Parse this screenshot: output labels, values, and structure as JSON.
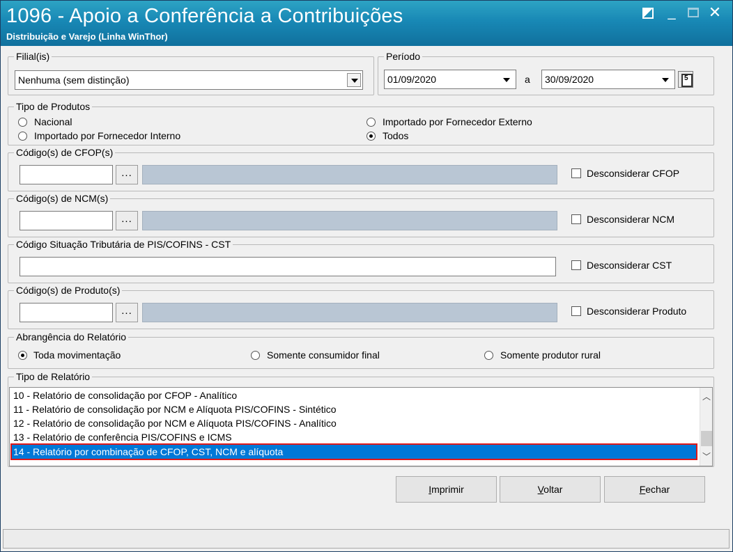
{
  "window": {
    "title": "1096 - Apoio a Conferência a Contribuições",
    "subtitle": "Distribuição e Varejo (Linha WinThor)",
    "minimize": "_",
    "close": "✕"
  },
  "filial": {
    "label": "Filial(is)",
    "value": "Nenhuma (sem distinção)"
  },
  "periodo": {
    "label": "Período",
    "start": "01/09/2020",
    "separator": "a",
    "end": "30/09/2020"
  },
  "tipo_produtos": {
    "label": "Tipo de Produtos",
    "options": [
      {
        "label": "Nacional",
        "checked": false
      },
      {
        "label": "Importado por Fornecedor Interno",
        "checked": false
      },
      {
        "label": "Importado por Fornecedor Externo",
        "checked": false
      },
      {
        "label": "Todos",
        "checked": true
      }
    ]
  },
  "cfop": {
    "label": "Código(s) de CFOP(s)",
    "button": "...",
    "checkbox": "Desconsiderar CFOP"
  },
  "ncm": {
    "label": "Código(s) de NCM(s)",
    "button": "...",
    "checkbox": "Desconsiderar NCM"
  },
  "cst": {
    "label": "Código Situação Tributária de PIS/COFINS - CST",
    "checkbox": "Desconsiderar CST"
  },
  "produto": {
    "label": "Código(s) de Produto(s)",
    "button": "...",
    "checkbox": "Desconsiderar Produto"
  },
  "abrangencia": {
    "label": "Abrangência do Relatório",
    "options": [
      {
        "label": "Toda movimentação",
        "checked": true
      },
      {
        "label": "Somente consumidor final",
        "checked": false
      },
      {
        "label": "Somente produtor rural",
        "checked": false
      }
    ]
  },
  "tipo_relatorio": {
    "label": "Tipo de Relatório",
    "items": [
      "10 - Relatório de consolidação por CFOP - Analítico",
      "11 - Relatório de consolidação por NCM e Alíquota PIS/COFINS - Sintético",
      "12 - Relatório de consolidação por NCM e Alíquota PIS/COFINS - Analítico",
      "13 - Relatório de conferência PIS/COFINS e ICMS",
      "14 - Relatório por combinação de CFOP, CST, NCM e alíquota"
    ],
    "selected_index": 4
  },
  "buttons": {
    "imprimir_first": "I",
    "imprimir_rest": "mprimir",
    "voltar_first": "V",
    "voltar_rest": "oltar",
    "fechar_first": "F",
    "fechar_rest": "echar"
  }
}
